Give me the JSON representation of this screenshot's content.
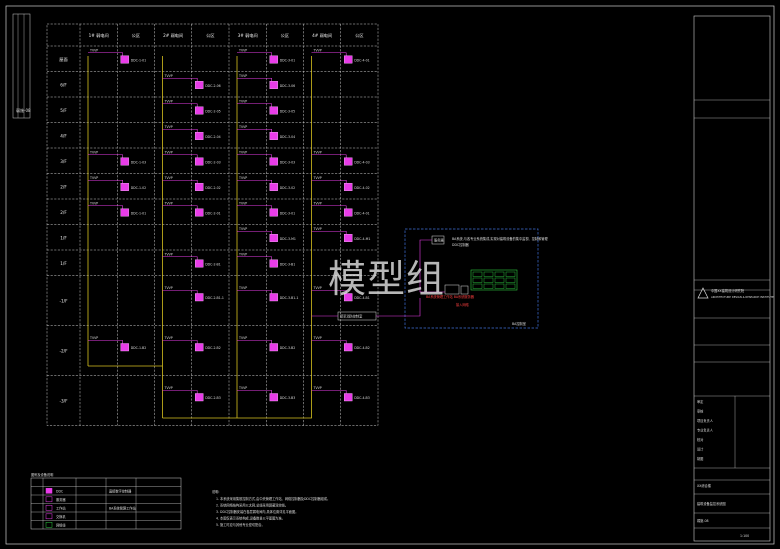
{
  "watermark": "模型组",
  "columns": [
    {
      "header": "1# 弱电间",
      "kind": "room"
    },
    {
      "header": "公区",
      "kind": "area"
    },
    {
      "header": "2# 弱电间",
      "kind": "room"
    },
    {
      "header": "公区",
      "kind": "area"
    },
    {
      "header": "3# 弱电间",
      "kind": "room"
    },
    {
      "header": "公区",
      "kind": "area"
    },
    {
      "header": "4# 弱电间",
      "kind": "room"
    },
    {
      "header": "公区",
      "kind": "area"
    }
  ],
  "floors": [
    {
      "label": "屋面",
      "tall": false
    },
    {
      "label": "6/F",
      "tall": false
    },
    {
      "label": "5/F",
      "tall": false
    },
    {
      "label": "4/F",
      "tall": false
    },
    {
      "label": "3/F",
      "tall": false
    },
    {
      "label": "2/F",
      "tall": false
    },
    {
      "label": "2/F",
      "tall": false
    },
    {
      "label": "1/F",
      "tall": false
    },
    {
      "label": "1/F",
      "tall": false
    },
    {
      "label": "-1/F",
      "tall": true
    },
    {
      "label": "-2/F",
      "tall": true
    },
    {
      "label": "-3/F",
      "tall": true
    }
  ],
  "devices": [
    {
      "row": 0,
      "col": 1,
      "label": "DDC-1-01"
    },
    {
      "row": 0,
      "col": 5,
      "label": "DDC-3-01"
    },
    {
      "row": 0,
      "col": 7,
      "label": "DDC-4-01"
    },
    {
      "row": 1,
      "col": 3,
      "label": "DDC-2-06"
    },
    {
      "row": 1,
      "col": 5,
      "label": "DDC-3-06"
    },
    {
      "row": 2,
      "col": 3,
      "label": "DDC-2-05"
    },
    {
      "row": 2,
      "col": 5,
      "label": "DDC-3-05"
    },
    {
      "row": 3,
      "col": 3,
      "label": "DDC-2-04"
    },
    {
      "row": 3,
      "col": 5,
      "label": "DDC-3-04"
    },
    {
      "row": 4,
      "col": 1,
      "label": "DDC-1-03"
    },
    {
      "row": 4,
      "col": 3,
      "label": "DDC-2-03"
    },
    {
      "row": 4,
      "col": 5,
      "label": "DDC-3-03"
    },
    {
      "row": 4,
      "col": 7,
      "label": "DDC-4-03"
    },
    {
      "row": 5,
      "col": 1,
      "label": "DDC-1-02"
    },
    {
      "row": 5,
      "col": 3,
      "label": "DDC-2-02"
    },
    {
      "row": 5,
      "col": 5,
      "label": "DDC-3-02"
    },
    {
      "row": 5,
      "col": 7,
      "label": "DDC-4-02"
    },
    {
      "row": 6,
      "col": 1,
      "label": "DDC-1-01"
    },
    {
      "row": 6,
      "col": 3,
      "label": "DDC-2-01"
    },
    {
      "row": 6,
      "col": 5,
      "label": "DDC-3-01"
    },
    {
      "row": 6,
      "col": 7,
      "label": "DDC-4-01"
    },
    {
      "row": 7,
      "col": 5,
      "label": "DDC-3-M1"
    },
    {
      "row": 7,
      "col": 7,
      "label": "DDC-4-M1"
    },
    {
      "row": 8,
      "col": 3,
      "label": "DDC-2-B1"
    },
    {
      "row": 8,
      "col": 5,
      "label": "DDC-3-B1"
    },
    {
      "row": 9,
      "col": 3,
      "label": "DDC-2-B1-1"
    },
    {
      "row": 9,
      "col": 5,
      "label": "DDC-3-B1-1"
    },
    {
      "row": 9,
      "col": 7,
      "label": "DDC-4-B1"
    },
    {
      "row": 10,
      "col": 1,
      "label": "DDC-1-B2"
    },
    {
      "row": 10,
      "col": 3,
      "label": "DDC-2-B2"
    },
    {
      "row": 10,
      "col": 5,
      "label": "DDC-3-B2"
    },
    {
      "row": 10,
      "col": 7,
      "label": "DDC-4-B2"
    },
    {
      "row": 11,
      "col": 3,
      "label": "DDC-2-B3"
    },
    {
      "row": 11,
      "col": 5,
      "label": "DDC-3-B3"
    },
    {
      "row": 11,
      "col": 7,
      "label": "DDC-4-B3"
    }
  ],
  "control_room": {
    "title": "BA控制室",
    "server_label": "服务器",
    "note": "DDC控制器",
    "red_note_1": "BA系统管理工作站 BA系统服务器",
    "red_note_2": "接入网络",
    "desc": "BA系统,与各专业系统集成,实现对建筑设备的集中监视、控制和管理",
    "link_label": "接至消防控制室"
  },
  "legend": {
    "title": "图例及设备说明",
    "rows": [
      {
        "icon": "",
        "name": "DDC",
        "desc": "直接数字控制器"
      },
      {
        "icon": "",
        "name": "服务器",
        "desc": ""
      },
      {
        "icon": "",
        "name": "工作站",
        "desc": "BA系统管理工作站"
      },
      {
        "icon": "",
        "name": "交换机",
        "desc": ""
      },
      {
        "icon": "",
        "name": "网络线",
        "desc": ""
      }
    ]
  },
  "notes": {
    "title": "说明:",
    "lines": [
      "1. 本系统采用集散控制方式,由中央管理工作站、网络控制器及DDC控制器组成。",
      "2. 系统网络结构采用以太网,总线采用屏蔽双绞线。",
      "3. DDC控制器安装在各层弱电间内,具体位置详见平面图。",
      "4. 本图仅表示系统构成,设备数量以平面图为准。",
      "5. 施工时应与其他专业密切配合。"
    ]
  },
  "title_block": {
    "company": "中国XX建筑设计研究院",
    "company_en": "ARCHITECTURE DESIGN & RESEARCH INSTITUTE",
    "project": "XX综合楼",
    "drawing_title": "建筑设备监控系统图",
    "drawing_no": "弱施-08",
    "scale": "1:100",
    "rows": [
      "审定",
      "审核",
      "项目负责人",
      "专业负责人",
      "校对",
      "设计",
      "制图"
    ]
  }
}
